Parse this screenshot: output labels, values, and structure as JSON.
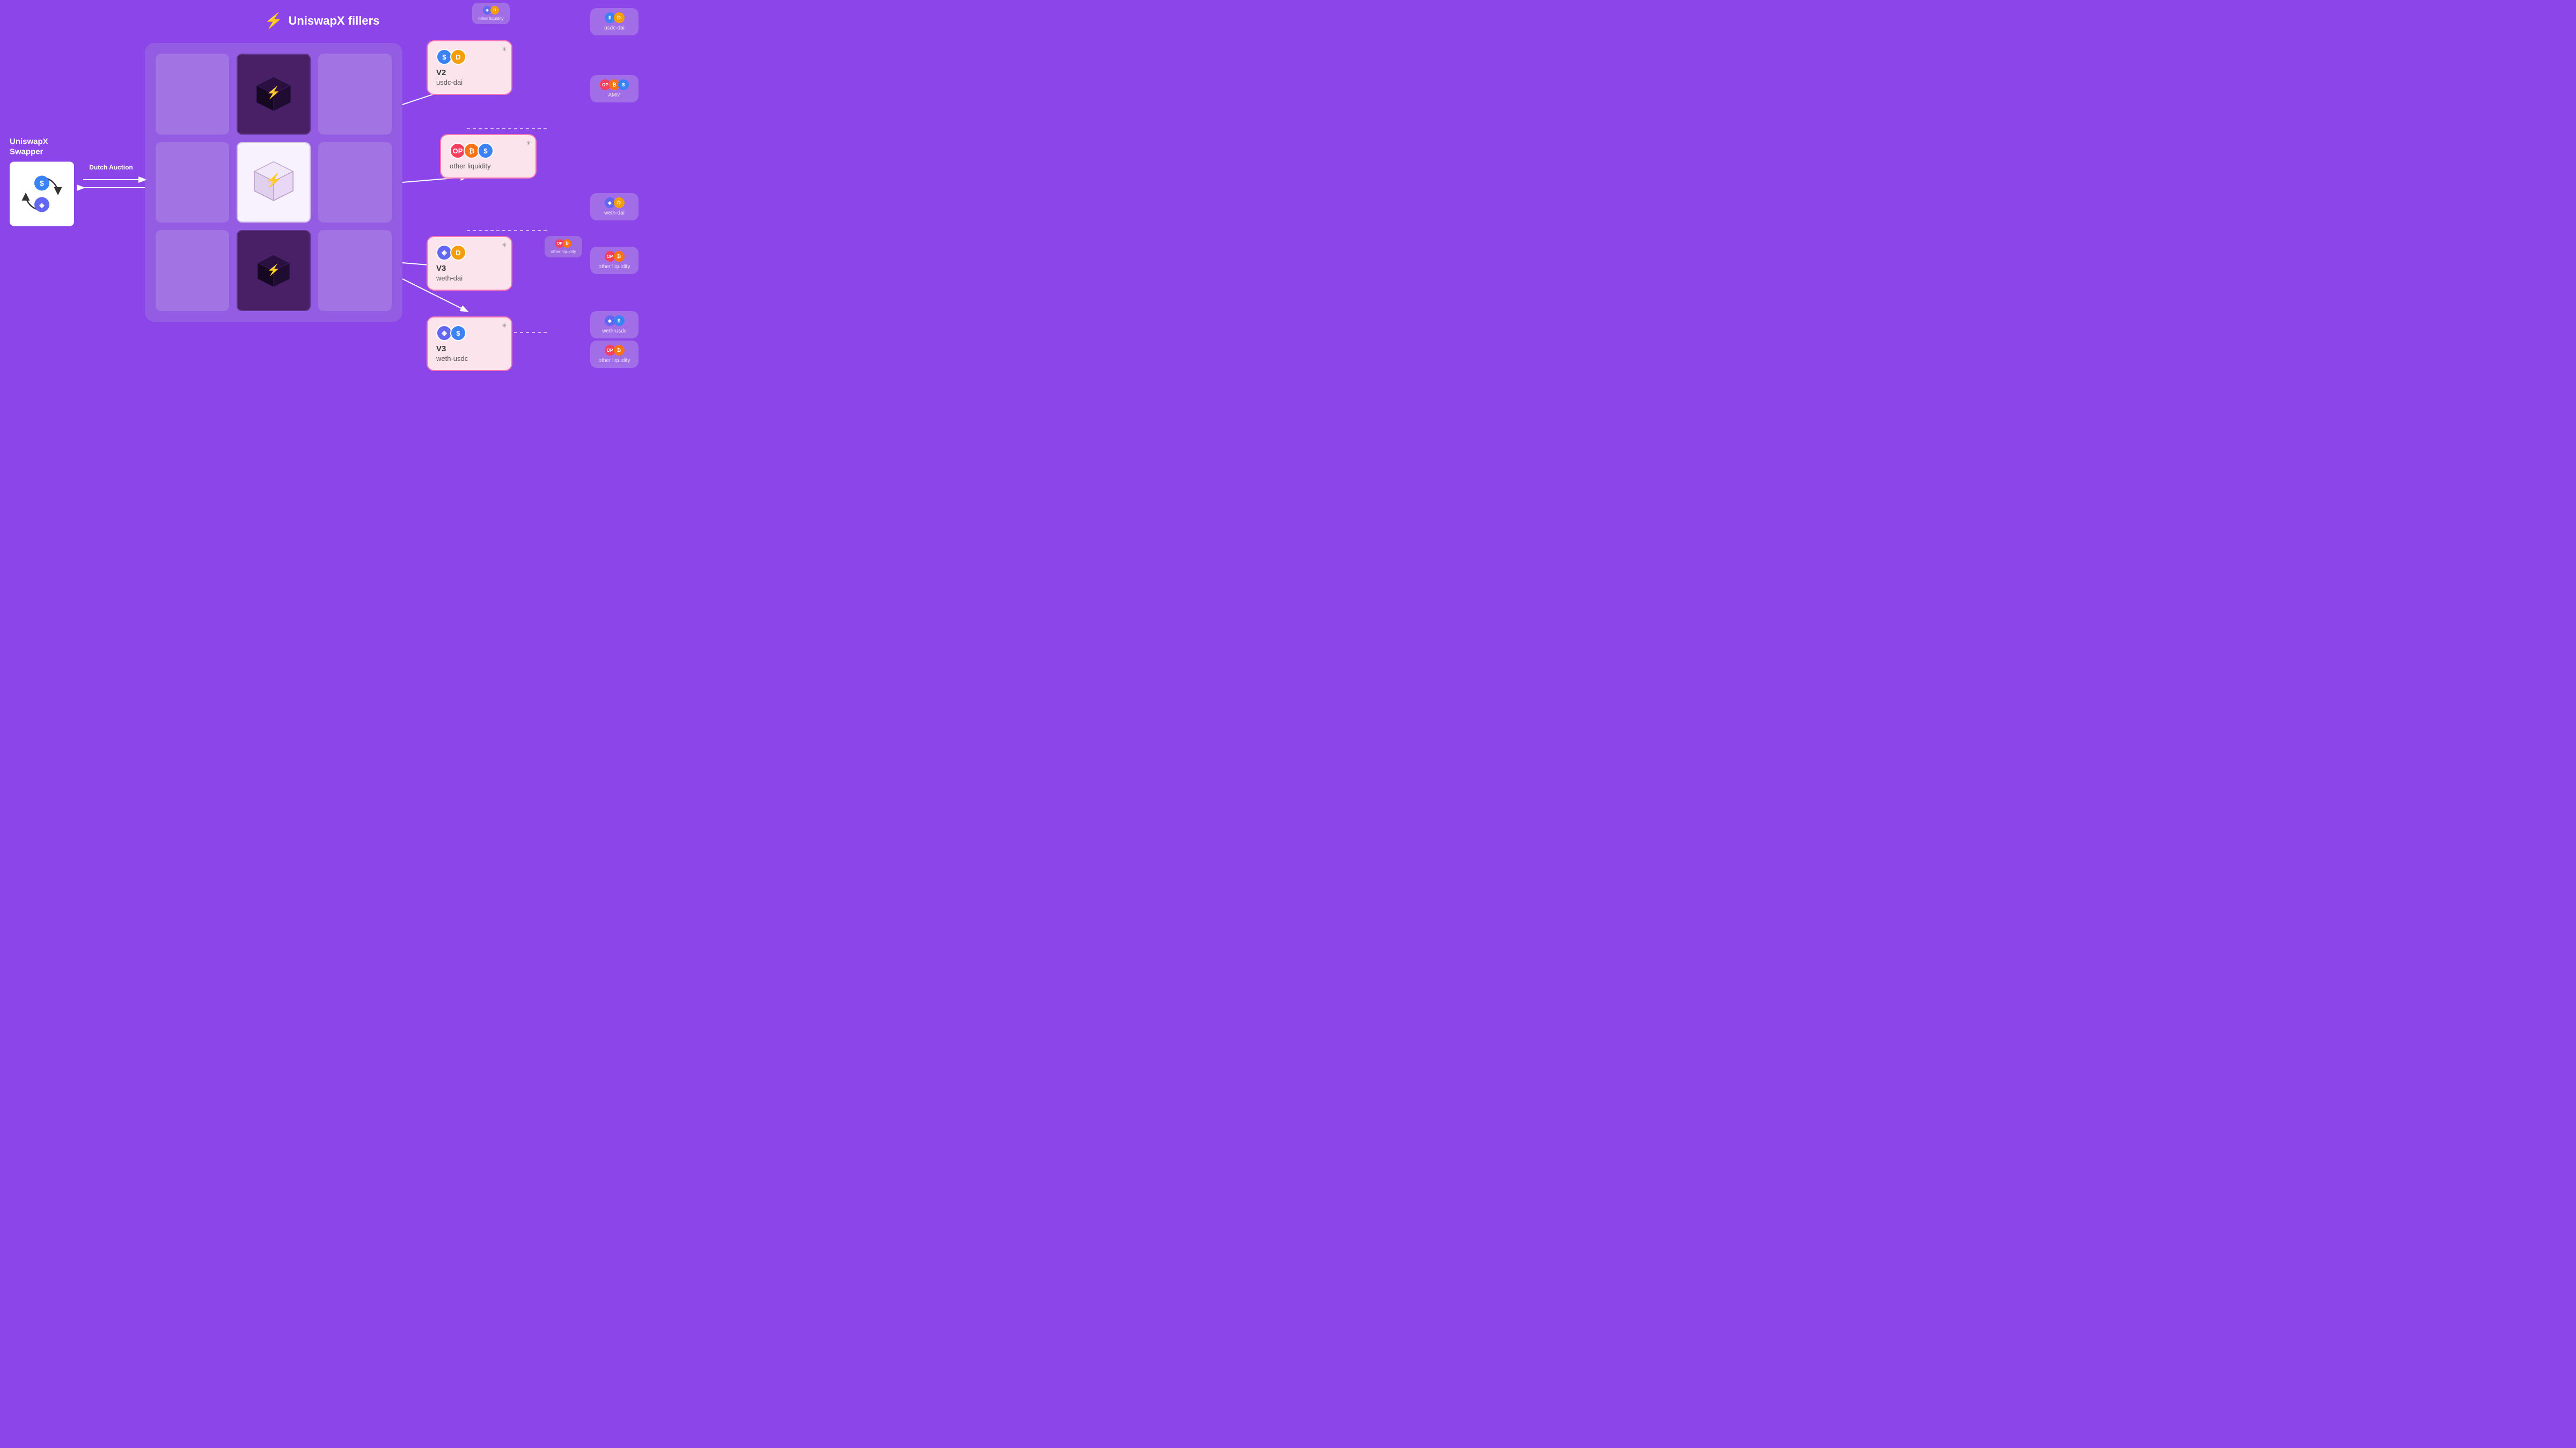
{
  "header": {
    "title": "UniswapX fillers",
    "bolt_icon": "⚡"
  },
  "swapper": {
    "label_line1": "UniswapX",
    "label_line2": "Swapper",
    "coins": [
      "$",
      "◈"
    ]
  },
  "dutch_auction": {
    "label": "Dutch Auction"
  },
  "pools": [
    {
      "id": "v2-usdc-dai",
      "version": "V2",
      "pair": "usdc-dai",
      "coins": [
        "dollar",
        "dai"
      ],
      "active": true
    },
    {
      "id": "amm",
      "version": "",
      "pair": "AMM",
      "coins": [
        "op",
        "btc",
        "dollar"
      ],
      "active": false
    },
    {
      "id": "other-liquidity-1",
      "version": "",
      "pair": "other liquidity",
      "coins": [
        "op",
        "btc",
        "dollar"
      ],
      "active": true
    },
    {
      "id": "v3-weth-dai",
      "version": "V3",
      "pair": "weth-dai",
      "coins": [
        "eth",
        "dai"
      ],
      "active": true
    },
    {
      "id": "v3-weth-usdc",
      "version": "V3",
      "pair": "weth-usdc",
      "coins": [
        "eth",
        "dollar"
      ],
      "active": true
    }
  ],
  "bg_cards": [
    {
      "label": "usdc-dai",
      "coins": []
    },
    {
      "label": "AMM",
      "coins": [
        "op",
        "btc",
        "dollar"
      ]
    },
    {
      "label": "weth-dai",
      "coins": []
    },
    {
      "label": "other liquidity",
      "coins": [
        "op",
        "btc"
      ]
    },
    {
      "label": "weth-usdc",
      "coins": []
    },
    {
      "label": "other liquidity",
      "coins": [
        "op",
        "btc"
      ]
    }
  ],
  "colors": {
    "background": "#8b45e8",
    "card_bg": "#fce4ec",
    "card_border": "#f472b6",
    "coin_dollar": "#3b82f6",
    "coin_eth": "#6366f1",
    "coin_dai": "#f59e0b",
    "coin_op": "#f43f5e",
    "coin_btc": "#f97316"
  }
}
